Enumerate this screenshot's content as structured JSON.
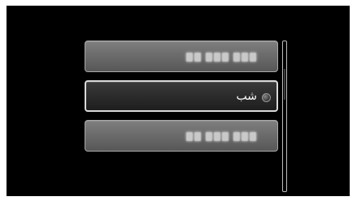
{
  "menu": {
    "items": [
      {
        "label": "",
        "selected": false,
        "placeholder": true
      },
      {
        "label": "شب",
        "selected": true,
        "placeholder": false,
        "indicator_icon": "radio-dot-icon"
      },
      {
        "label": "",
        "selected": false,
        "placeholder": true
      }
    ]
  },
  "colors": {
    "background": "#000000",
    "item_fill": "#6a6a6a",
    "item_selected_fill": "#2a2a2a",
    "item_border": "#a9a9a9",
    "selected_border": "#d9d9d9",
    "text": "#ffffff"
  }
}
